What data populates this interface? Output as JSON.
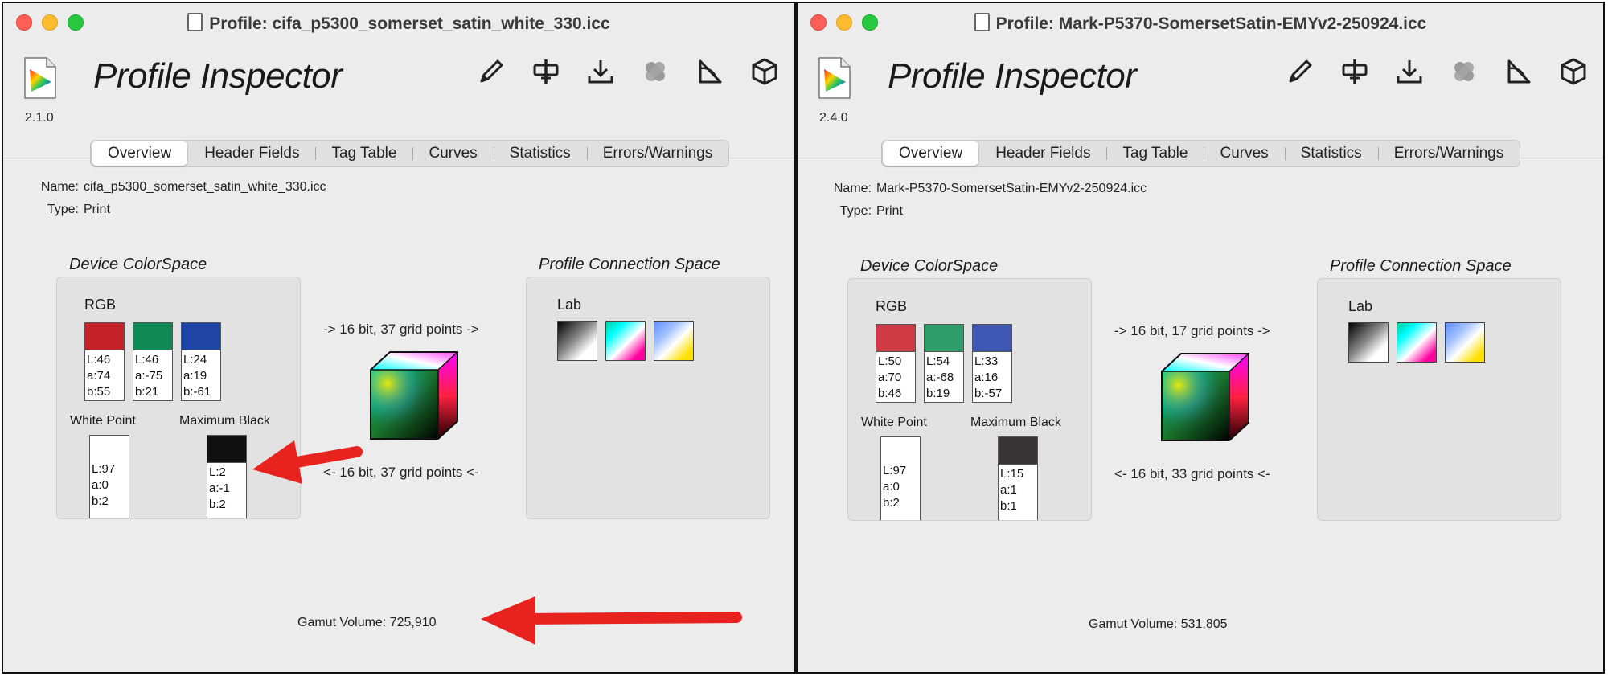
{
  "windows": [
    {
      "title": "Profile: cifa_p5300_somerset_satin_white_330.icc",
      "app_name": "Profile Inspector",
      "version": "2.1.0",
      "toolbar_icons": [
        "pencil-icon",
        "compare-icon",
        "download-icon",
        "bandage-icon",
        "gamut-icon",
        "cube-icon"
      ],
      "tabs": [
        "Overview",
        "Header Fields",
        "Tag Table",
        "Curves",
        "Statistics",
        "Errors/Warnings"
      ],
      "active_tab": "Overview",
      "name_label": "Name:",
      "name_value": "cifa_p5300_somerset_satin_white_330.icc",
      "type_label": "Type:",
      "type_value": "Print",
      "device_title": "Device ColorSpace",
      "device_space": "RGB",
      "primaries": [
        {
          "color": "#c42228",
          "L": "L:46",
          "a": "a:74",
          "b": "b:55"
        },
        {
          "color": "#0f8a57",
          "L": "L:46",
          "a": "a:-75",
          "b": "b:21"
        },
        {
          "color": "#1e45a6",
          "L": "L:24",
          "a": "a:19",
          "b": "b:-61"
        }
      ],
      "white_point": {
        "label": "White Point",
        "color": "#ffffff",
        "L": "L:97",
        "a": "a:0",
        "b": "b:2"
      },
      "max_black": {
        "label": "Maximum Black",
        "color": "#111111",
        "L": "L:2",
        "a": "a:-1",
        "b": "b:2"
      },
      "forward_text": "-> 16 bit, 37 grid points ->",
      "reverse_text": "<- 16 bit, 37 grid points <-",
      "pcs_title": "Profile Connection Space",
      "pcs_space": "Lab",
      "gamut_label": "Gamut Volume:",
      "gamut_value": "725,910",
      "annotation_color": "#e8231f"
    },
    {
      "title": "Profile: Mark-P5370-SomersetSatin-EMYv2-250924.icc",
      "app_name": "Profile Inspector",
      "version": "2.4.0",
      "toolbar_icons": [
        "pencil-icon",
        "compare-icon",
        "download-icon",
        "bandage-icon",
        "gamut-icon",
        "cube-icon"
      ],
      "tabs": [
        "Overview",
        "Header Fields",
        "Tag Table",
        "Curves",
        "Statistics",
        "Errors/Warnings"
      ],
      "active_tab": "Overview",
      "name_label": "Name:",
      "name_value": "Mark-P5370-SomersetSatin-EMYv2-250924.icc",
      "type_label": "Type:",
      "type_value": "Print",
      "device_title": "Device ColorSpace",
      "device_space": "RGB",
      "primaries": [
        {
          "color": "#cf3a44",
          "L": "L:50",
          "a": "a:70",
          "b": "b:46"
        },
        {
          "color": "#2f9d6a",
          "L": "L:54",
          "a": "a:-68",
          "b": "b:19"
        },
        {
          "color": "#3f58b3",
          "L": "L:33",
          "a": "a:16",
          "b": "b:-57"
        }
      ],
      "white_point": {
        "label": "White Point",
        "color": "#ffffff",
        "L": "L:97",
        "a": "a:0",
        "b": "b:2"
      },
      "max_black": {
        "label": "Maximum Black",
        "color": "#373435",
        "L": "L:15",
        "a": "a:1",
        "b": "b:1"
      },
      "forward_text": "-> 16 bit, 17 grid points ->",
      "reverse_text": "<- 16 bit, 33 grid points <-",
      "pcs_title": "Profile Connection Space",
      "pcs_space": "Lab",
      "gamut_label": "Gamut Volume:",
      "gamut_value": "531,805"
    }
  ]
}
